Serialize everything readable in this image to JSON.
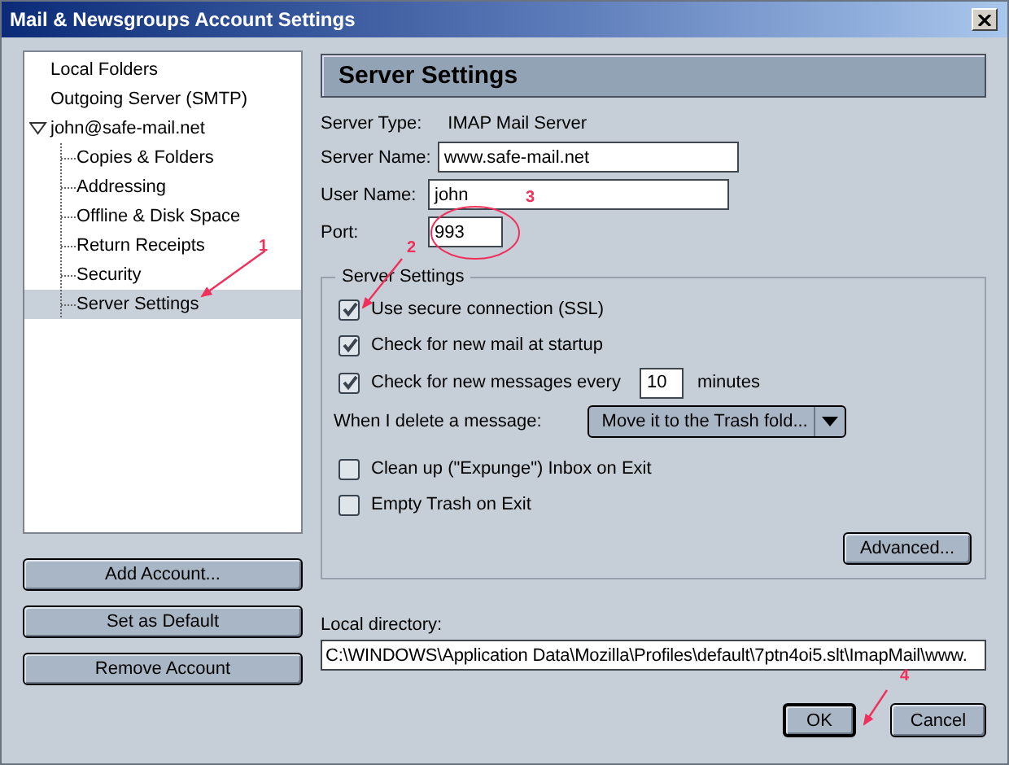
{
  "window": {
    "title": "Mail & Newsgroups Account Settings"
  },
  "account_tree": [
    {
      "label": "Local Folders",
      "selected": false
    },
    {
      "label": "Outgoing Server (SMTP)",
      "selected": false
    },
    {
      "label": "john@safe-mail.net",
      "selected": false,
      "expanded": true,
      "children": [
        {
          "label": "Copies & Folders",
          "selected": false
        },
        {
          "label": "Addressing",
          "selected": false
        },
        {
          "label": "Offline & Disk Space",
          "selected": false
        },
        {
          "label": "Return Receipts",
          "selected": false
        },
        {
          "label": "Security",
          "selected": false
        },
        {
          "label": "Server Settings",
          "selected": true
        }
      ]
    }
  ],
  "account_buttons": [
    "Add Account...",
    "Set as Default",
    "Remove Account"
  ],
  "panel": {
    "title": "Server Settings",
    "server_type": {
      "label": "Server Type:",
      "value": "IMAP Mail Server"
    },
    "fields": [
      {
        "label": "Server Name:",
        "value": "www.safe-mail.net"
      },
      {
        "label": "User Name:",
        "value": "john"
      },
      {
        "label": "Port:",
        "value": "993"
      }
    ]
  },
  "server_settings_group": {
    "title": "Server Settings",
    "options": [
      {
        "kind": "checkbox",
        "label": "Use secure connection (SSL)",
        "checked": true
      },
      {
        "kind": "checkbox",
        "label": "Check for new mail at startup",
        "checked": true
      },
      {
        "kind": "interval",
        "label": "Check for new messages every",
        "checked": true,
        "value": "10",
        "unit": "minutes"
      },
      {
        "kind": "dropdown",
        "label": "When I delete a message:",
        "value": "Move it to the Trash fold..."
      },
      {
        "kind": "checkbox",
        "label": "Clean up (\"Expunge\") Inbox on Exit",
        "checked": false
      },
      {
        "kind": "checkbox",
        "label": "Empty Trash on Exit",
        "checked": false
      }
    ],
    "advanced_button": "Advanced..."
  },
  "local_directory": {
    "label": "Local directory:",
    "value": "C:\\WINDOWS\\Application Data\\Mozilla\\Profiles\\default\\7ptn4oi5.slt\\ImapMail\\www."
  },
  "buttons": [
    {
      "label": "OK",
      "default": true
    },
    {
      "label": "Cancel",
      "default": false
    }
  ],
  "annotations": [
    {
      "kind": "arrow",
      "label": "1"
    },
    {
      "kind": "arrow",
      "label": "2"
    },
    {
      "kind": "circle",
      "label": "3"
    },
    {
      "kind": "arrow",
      "label": "4"
    }
  ]
}
